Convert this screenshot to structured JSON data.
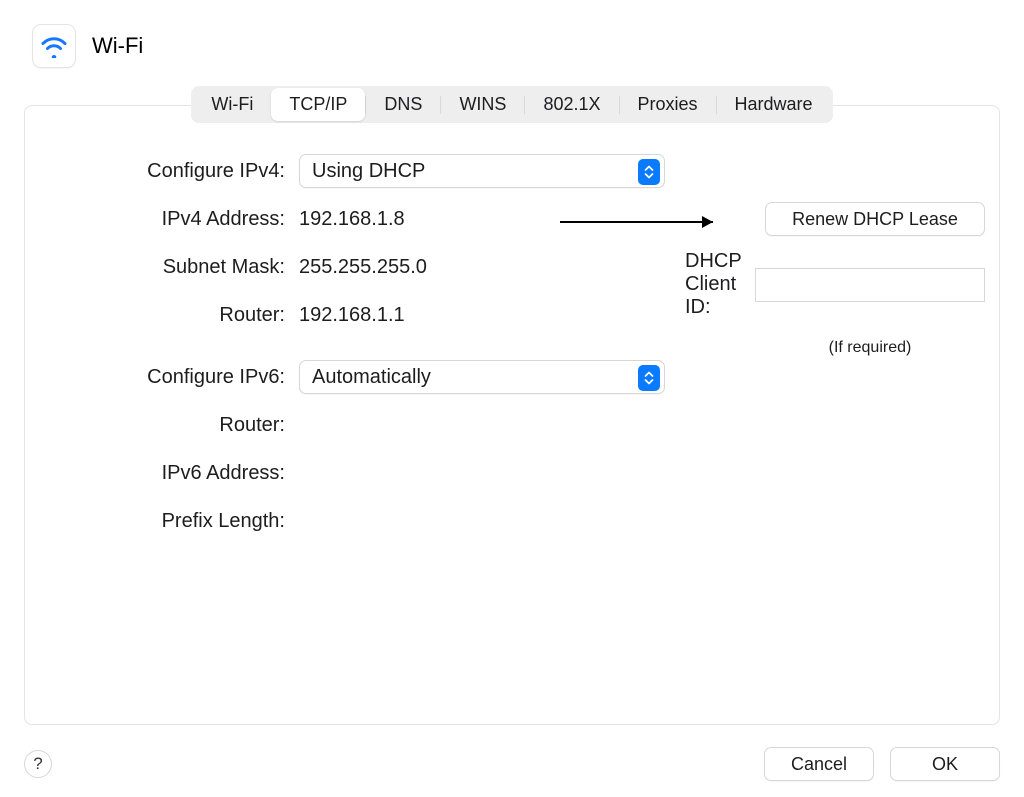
{
  "header": {
    "title": "Wi-Fi"
  },
  "tabs": {
    "items": [
      "Wi-Fi",
      "TCP/IP",
      "DNS",
      "WINS",
      "802.1X",
      "Proxies",
      "Hardware"
    ],
    "active_index": 1
  },
  "form": {
    "configure_ipv4_label": "Configure IPv4:",
    "configure_ipv4_value": "Using DHCP",
    "ipv4_address_label": "IPv4 Address:",
    "ipv4_address_value": "192.168.1.8",
    "subnet_mask_label": "Subnet Mask:",
    "subnet_mask_value": "255.255.255.0",
    "router_label": "Router:",
    "router_value": "192.168.1.1",
    "configure_ipv6_label": "Configure IPv6:",
    "configure_ipv6_value": "Automatically",
    "router6_label": "Router:",
    "router6_value": "",
    "ipv6_address_label": "IPv6 Address:",
    "ipv6_address_value": "",
    "prefix_length_label": "Prefix Length:",
    "prefix_length_value": ""
  },
  "sidebar_right": {
    "renew_label": "Renew DHCP Lease",
    "client_id_label": "DHCP Client ID:",
    "client_id_value": "",
    "client_id_hint": "(If required)"
  },
  "footer": {
    "cancel": "Cancel",
    "ok": "OK",
    "help": "?"
  }
}
